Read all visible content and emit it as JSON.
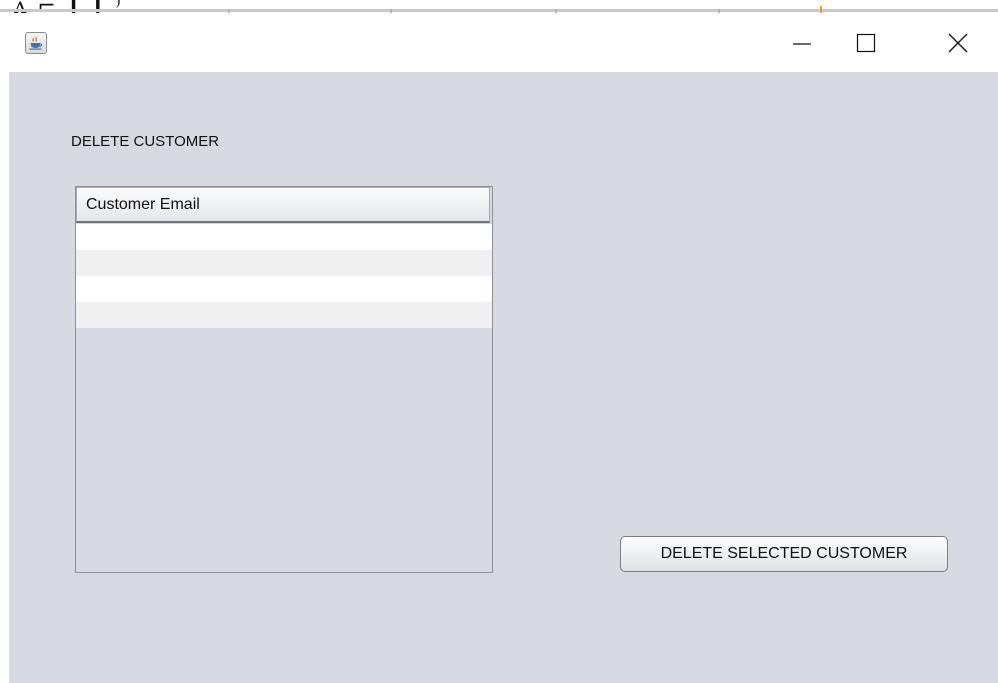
{
  "background_window": {
    "partial_text": "ᴧ̃ ⌐ ┃ ┃ ⁾"
  },
  "window": {
    "icon": "java-coffee-icon",
    "controls": {
      "minimize_icon": "minimize-icon",
      "maximize_icon": "maximize-icon",
      "close_icon": "close-icon"
    }
  },
  "content": {
    "heading": "DELETE CUSTOMER",
    "table": {
      "columns": [
        "Customer Email"
      ],
      "rows": [
        "",
        "",
        "",
        ""
      ]
    },
    "delete_button_label": "DELETE SELECTED CUSTOMER"
  },
  "colors": {
    "panel_background": "#d6d9e0",
    "titlebar_background": "#ffffff",
    "row_white": "#ffffff",
    "row_alt": "#f0f0f0"
  }
}
